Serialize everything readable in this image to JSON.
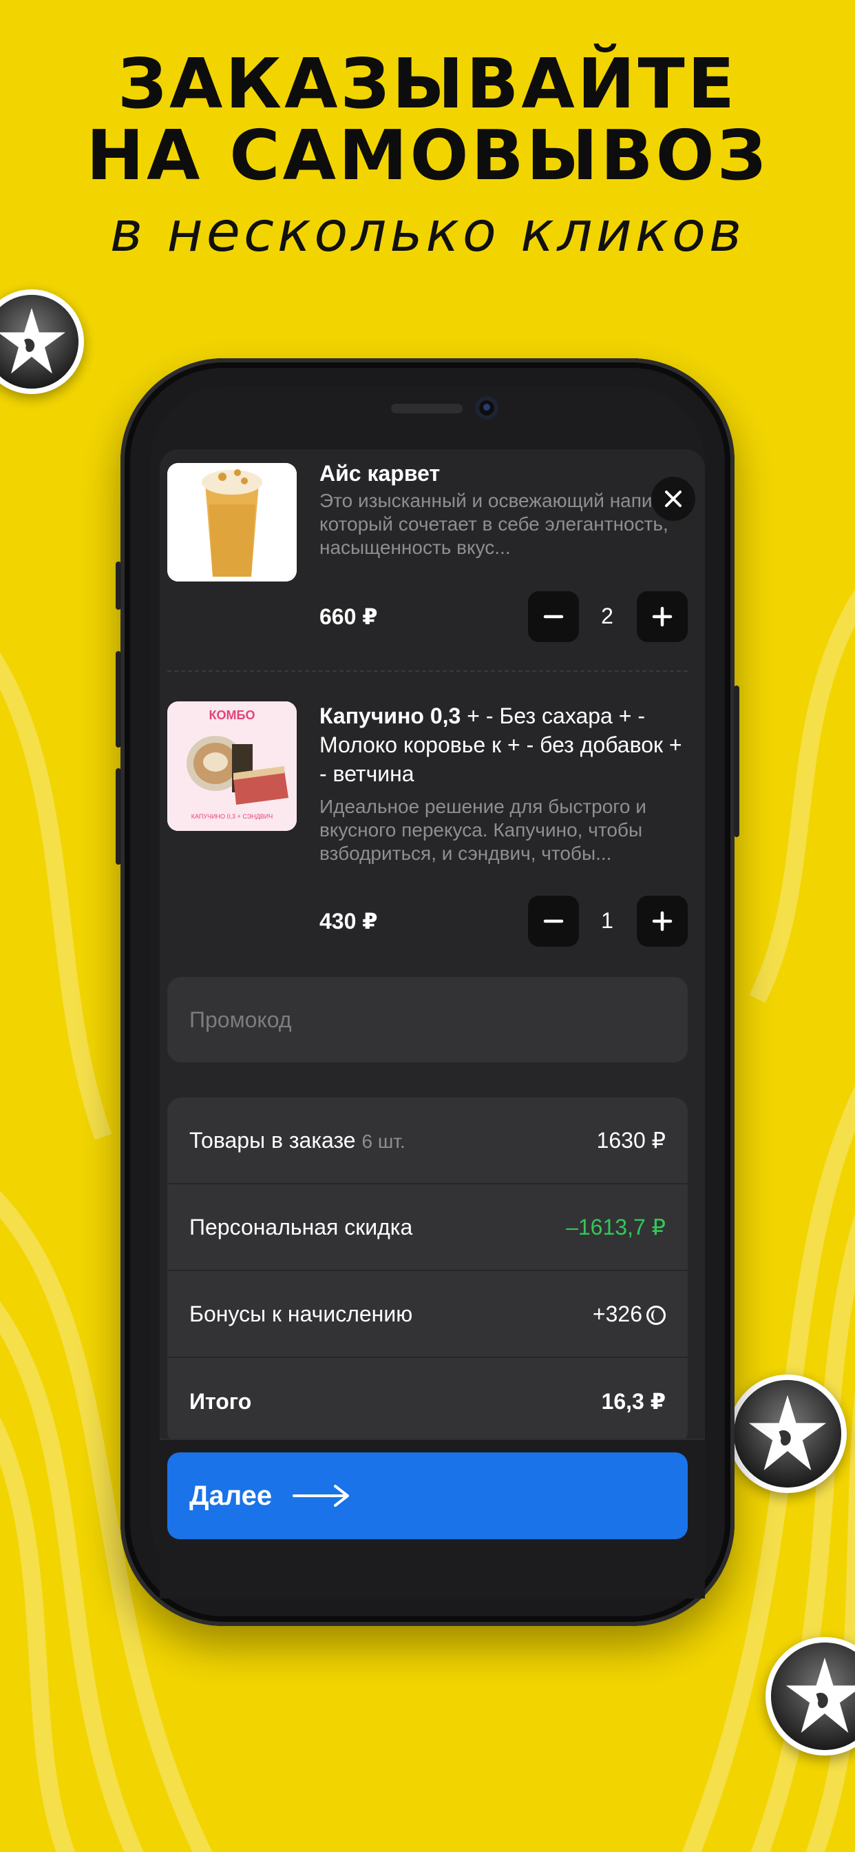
{
  "promo_banner": {
    "headline_line1": "ЗАКАЗЫВАЙТЕ",
    "headline_line2": "НА САМОВЫВОЗ",
    "subline": "в несколько кликов"
  },
  "cart": {
    "items": [
      {
        "title": "Айс карвет",
        "options": "",
        "description": "Это изысканный и освежающий напиток, который сочетает в себе элегантность, насыщенность вкус...",
        "price": "660 ₽",
        "quantity": "2",
        "thumbnail": "iced-drink"
      },
      {
        "title": "Капучино 0,3",
        "options": " + - Без сахара + - Молоко коровье к + - без добавок + - ветчина",
        "description": "Идеальное решение для быстрого и вкусного перекуса. Капучино, чтобы взбодриться, и сэндвич, чтобы...",
        "price": "430 ₽",
        "quantity": "1",
        "thumbnail": "combo",
        "thumb_badge": "КОМБО",
        "thumb_caption": "КАПУЧИНО 0,3 + СЭНДВИЧ"
      }
    ],
    "promo_placeholder": "Промокод",
    "summary": {
      "items_label": "Товары в заказе",
      "items_count": "6 шт.",
      "items_value": "1630 ₽",
      "discount_label": "Персональная скидка",
      "discount_value": "–1613,7 ₽",
      "bonus_label": "Бонусы к начислению",
      "bonus_value": "+326",
      "total_label": "Итого",
      "total_value": "16,3 ₽"
    },
    "next_label": "Далее"
  },
  "colors": {
    "background": "#f2d500",
    "accent": "#1a73e8",
    "discount": "#34c759",
    "sheet": "#262628"
  },
  "icons": [
    "close-icon",
    "minus-icon",
    "plus-icon",
    "arrow-right-icon",
    "bonus-coin-icon",
    "brand-star-logo"
  ]
}
